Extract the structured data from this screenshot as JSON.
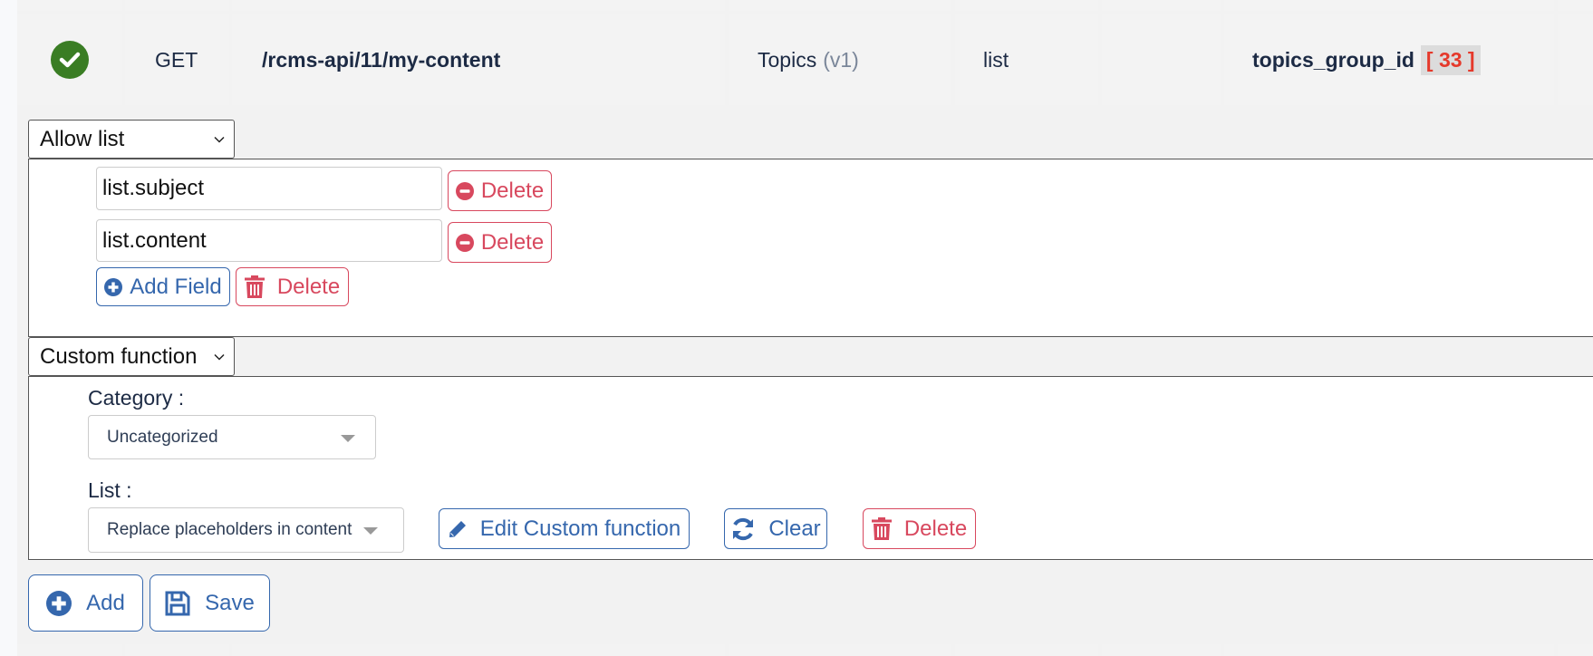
{
  "route_row": {
    "status_icon": "check-circle-icon",
    "method": "GET",
    "path": "/rcms-api/11/my-content",
    "module": "Topics",
    "module_version": "(v1)",
    "action": "list",
    "extra": "",
    "param_name": "topics_group_id",
    "param_value": "[ 33 ]"
  },
  "allow_list": {
    "select_value": "Allow list",
    "fields": [
      {
        "value": "list.subject",
        "delete_label": "Delete"
      },
      {
        "value": "list.content",
        "delete_label": "Delete"
      }
    ],
    "add_field_label": "Add Field",
    "delete_label": "Delete"
  },
  "custom_function": {
    "select_value": "Custom function",
    "category_label": "Category :",
    "category_value": "Uncategorized",
    "list_label": "List :",
    "list_value": "Replace placeholders in content",
    "edit_label": "Edit Custom function",
    "clear_label": "Clear",
    "delete_label": "Delete"
  },
  "footer": {
    "add_label": "Add",
    "save_label": "Save"
  },
  "colors": {
    "success": "#3a7d24",
    "danger": "#d8485e",
    "primary": "#3567ad",
    "badge_text": "#e5392b"
  }
}
